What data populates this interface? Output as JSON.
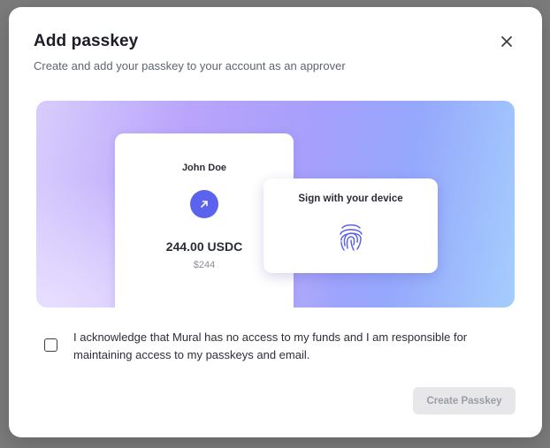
{
  "dialog": {
    "title": "Add passkey",
    "subtitle": "Create and add your passkey to your account as an approver",
    "close_icon": "close-icon"
  },
  "illustration": {
    "account_card": {
      "name": "John Doe",
      "icon": "arrow-up-right-icon",
      "amount": "244.00 USDC",
      "amount_fiat": "$244"
    },
    "sign_card": {
      "label": "Sign with your device",
      "icon": "fingerprint-icon"
    },
    "colors": {
      "accent": "#5b63ee",
      "gradient_start": "#d8cdfd",
      "gradient_end": "#a5cdfd"
    }
  },
  "acknowledgement": {
    "checked": false,
    "text": "I acknowledge that Mural has no access to my funds and I am responsible for maintaining access to my passkeys and email."
  },
  "actions": {
    "create_label": "Create Passkey",
    "create_enabled": false
  }
}
